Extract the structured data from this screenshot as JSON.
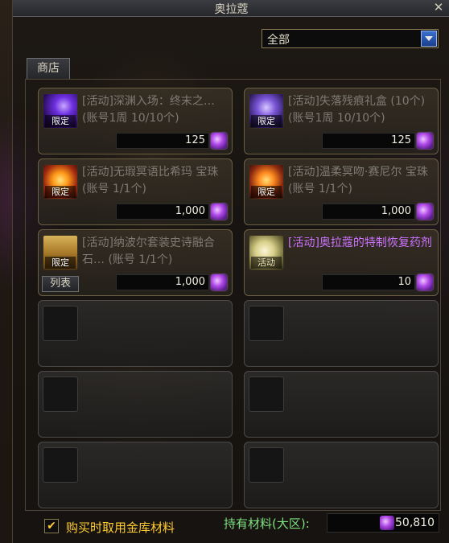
{
  "window": {
    "title": "奥拉蔻"
  },
  "filter": {
    "selected": "全部"
  },
  "tab": {
    "label": "商店"
  },
  "items": [
    {
      "name": "[活动]深渊入场：终末之… (账号1周 10/10个)",
      "badge": "限定",
      "price": "125",
      "available": false,
      "icon": "abyss-ticket-icon"
    },
    {
      "name": "[活动]失落残痕礼盒 (10个) (账号1周 10/10个)",
      "badge": "限定",
      "price": "125",
      "available": false,
      "icon": "lost-trace-box-icon"
    },
    {
      "name": "[活动]无瑕冥语比希玛 宝珠 (账号 1/1个)",
      "badge": "限定",
      "price": "1,000",
      "available": false,
      "icon": "orb-icon"
    },
    {
      "name": "[活动]温柔冥吻·赛尼尔 宝珠 (账号 1/1个)",
      "badge": "限定",
      "price": "1,000",
      "available": false,
      "icon": "orb-icon"
    },
    {
      "name": "[活动]纳波尔套装史诗融合石… (账号 1/1个)",
      "badge": "限定",
      "price": "1,000",
      "available": false,
      "icon": "fusion-stone-icon",
      "button": "列表"
    },
    {
      "name": "[活动]奥拉蔻的特制恢复药剂",
      "badge": "活动",
      "price": "10",
      "available": true,
      "icon": "potion-icon"
    }
  ],
  "footer": {
    "checkbox_label": "购买时取用金库材料",
    "checked": true,
    "material_label": "持有材料(大区):",
    "material_amount": "50,810"
  },
  "colors": {
    "active_item": "#cc73ff",
    "inactive_item": "#7e7b74",
    "checkbox_label": "#ffcc33",
    "material_label": "#7ee07e",
    "dropdown_arrow": "#3b6fd0"
  }
}
